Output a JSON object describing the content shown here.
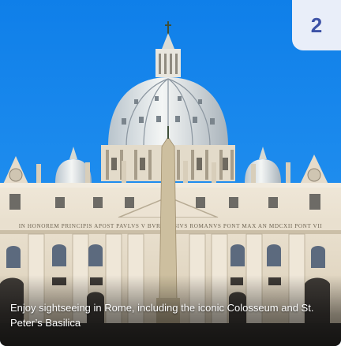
{
  "card": {
    "index_badge": "2",
    "caption": "Enjoy sightseeing in Rome, including the iconic Colosseum and St. Peter’s Basilica",
    "photo": {
      "subject": "St. Peter's Basilica facade and dome",
      "inscription": "IN HONOREM PRINCIPIS APOST PAVLVS V BVRGHESIVS ROMANVS PONT MAX AN MDCXII PONT VII"
    }
  },
  "colors": {
    "sky": "#1588f0",
    "badge_bg": "#e9eef9",
    "badge_text": "#3d52a6",
    "stone": "#e6dccb",
    "caption_text": "#ffffff"
  }
}
